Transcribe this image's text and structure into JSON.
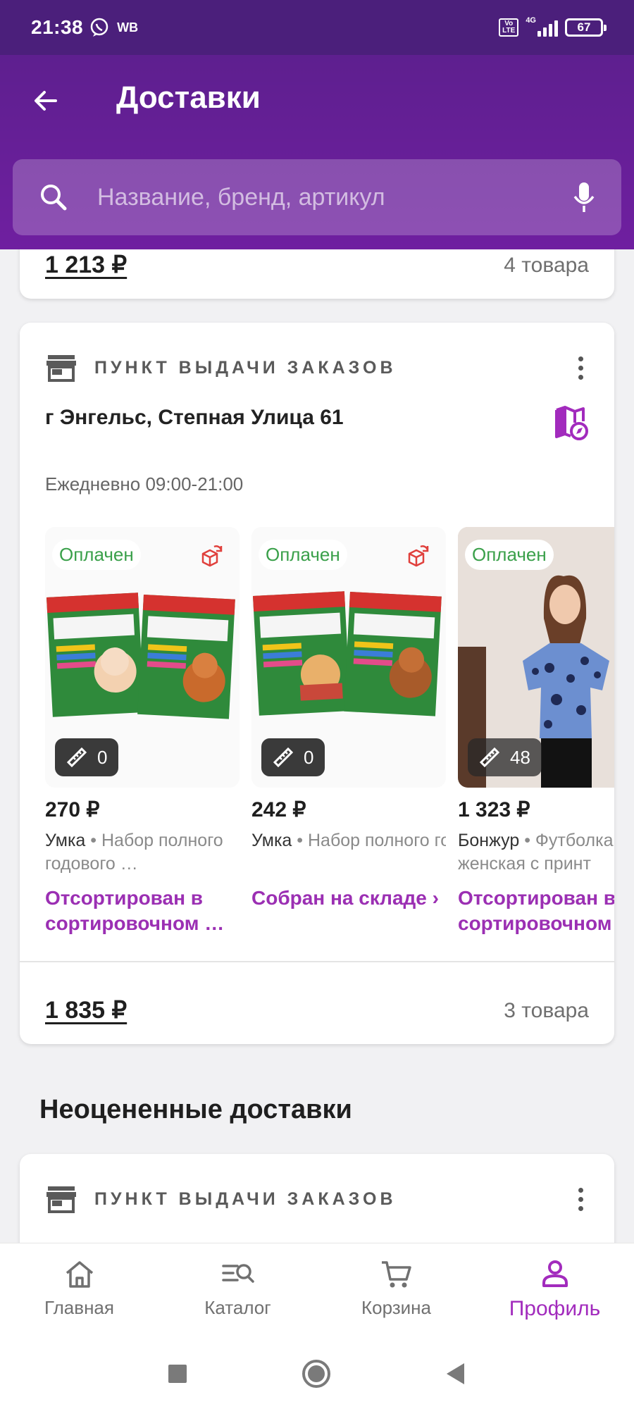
{
  "status_bar": {
    "time": "21:38",
    "carrier_tag": "WB",
    "volte": "Vo LTE",
    "network": "4G",
    "battery": "67"
  },
  "header": {
    "title": "Доставки"
  },
  "search": {
    "placeholder": "Название, бренд, артикул"
  },
  "previous_card": {
    "total": "1 213 ₽",
    "count": "4 товара"
  },
  "delivery_card": {
    "type_label": "ПУНКТ ВЫДАЧИ ЗАКАЗОВ",
    "address": "г Энгельс, Степная Улица 61",
    "hours": "Ежедневно 09:00-21:00",
    "products": [
      {
        "badge": "Оплачен",
        "size": "0",
        "price": "270 ₽",
        "brand": "Умка",
        "name": " • Набор полного годового …",
        "status": "Отсортирован в сортировочном …"
      },
      {
        "badge": "Оплачен",
        "size": "0",
        "price": "242 ₽",
        "brand": "Умка",
        "name": " • Набор полного годового …",
        "status": "Собран на складе ›"
      },
      {
        "badge": "Оплачен",
        "size": "48",
        "price": "1 323 ₽",
        "brand": "Бонжур",
        "name": " • Футболка женская с принт",
        "status": "Отсортирован в сортировочном"
      }
    ],
    "total": "1 835 ₽",
    "count": "3 товара"
  },
  "unrated_section": {
    "title": "Неоцененные доставки",
    "card_type_label": "ПУНКТ ВЫДАЧИ ЗАКАЗОВ"
  },
  "bottom_nav": [
    {
      "label": "Главная",
      "icon": "home-icon"
    },
    {
      "label": "Каталог",
      "icon": "catalog-icon"
    },
    {
      "label": "Корзина",
      "icon": "cart-icon"
    },
    {
      "label": "Профиль",
      "icon": "profile-icon",
      "active": true
    }
  ],
  "colors": {
    "primary": "#6f1fa0",
    "status_dark": "#4b1f7b",
    "accent": "#a22bbd",
    "paid_green": "#3aa04a"
  }
}
